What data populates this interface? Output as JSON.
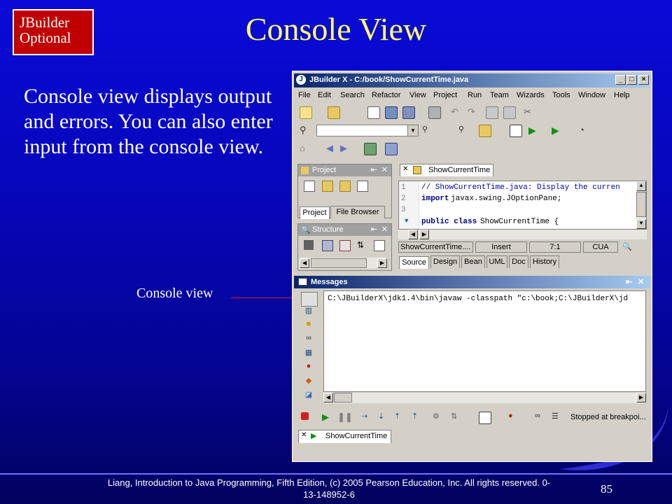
{
  "badge": {
    "line1": "JBuilder",
    "line2": "Optional"
  },
  "slide_title": "Console View",
  "body_text": "Console view displays output and errors. You can also enter input from the console view.",
  "callout_label": "Console view",
  "footer": {
    "citation": "Liang, Introduction to Java Programming, Fifth Edition, (c) 2005 Pearson Education, Inc. All rights reserved. 0-13-148952-6",
    "page_number": "85"
  },
  "window": {
    "title": "JBuilder X - C:/book/ShowCurrentTime.java",
    "menu": [
      "File",
      "Edit",
      "Search",
      "Refactor",
      "View",
      "Project",
      "Run",
      "Team",
      "Wizards",
      "Tools",
      "Window",
      "Help"
    ],
    "project_panel": {
      "title": "Project",
      "tabs": [
        "Project",
        "File Browser"
      ]
    },
    "structure_panel": {
      "title": "Structure"
    },
    "editor_tab": "ShowCurrentTime",
    "code": [
      {
        "num": "1",
        "text": "// ShowCurrentTime.java: Display the curren"
      },
      {
        "num": "2",
        "keyword": "import",
        "text": " javax.swing.JOptionPane;"
      },
      {
        "num": "3",
        "text": ""
      },
      {
        "num": "",
        "keyword": "public class",
        "text": " ShowCurrentTime {"
      }
    ],
    "status": {
      "file": "ShowCurrentTime....",
      "mode": "Insert",
      "position": "7:1",
      "keymap": "CUA"
    },
    "editor_view_tabs": [
      "Source",
      "Design",
      "Bean",
      "UML",
      "Doc",
      "History"
    ],
    "messages": {
      "title": "Messages",
      "output": "C:\\JBuilderX\\jdk1.4\\bin\\javaw -classpath \"c:\\book;C:\\JBuilderX\\jd",
      "debug_status": "Stopped at breakpoi...",
      "run_tab": "ShowCurrentTime"
    }
  },
  "colors": {
    "background": "#0a0ad8",
    "title": "#ffff66",
    "badge": "#c00000",
    "callout_line": "#d02020"
  }
}
